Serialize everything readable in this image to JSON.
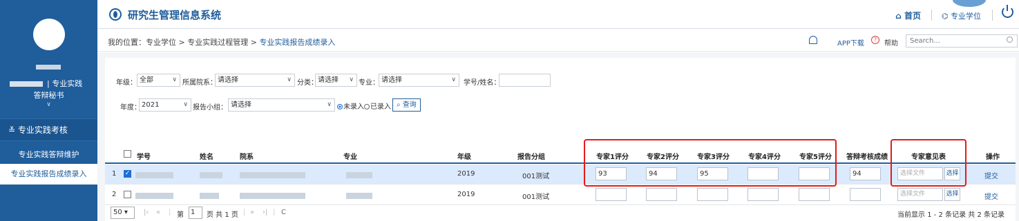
{
  "header": {
    "app_title": "研究生管理信息系统",
    "home": "首页",
    "degree": "专业学位"
  },
  "sidebar": {
    "role_suffix": "| 专业实践",
    "role_sub": "答辩秘书",
    "section": "专业实践考核",
    "items": [
      {
        "label": "专业实践答辩维护"
      },
      {
        "label": "专业实践报告成绩录入"
      }
    ]
  },
  "breadcrumb": {
    "prefix": "我的位置：",
    "path": "专业学位 > 专业实践过程管理 > ",
    "current": "专业实践报告成绩录入"
  },
  "toolbar": {
    "app_download": "APP下载",
    "help": "帮助",
    "search_placeholder": "Search..."
  },
  "filters": {
    "grade_label": "年级：",
    "grade_value": "全部",
    "college_label": "所属院系：",
    "college_value": "请选择",
    "category_label": "分类：",
    "category_value": "请选择",
    "major_label": "专业：",
    "major_value": "请选择",
    "student_label": "学号/姓名：",
    "year_label": "年度：",
    "year_value": "2021",
    "group_label": "报告小组：",
    "group_value": "请选择",
    "radio_unentered": "未录入",
    "radio_entered": "已录入",
    "query_button": "查询"
  },
  "table": {
    "columns": {
      "id": "学号",
      "name": "姓名",
      "college": "院系",
      "major": "专业",
      "grade": "年级",
      "group": "报告分组",
      "s1": "专家1评分",
      "s2": "专家2评分",
      "s3": "专家3评分",
      "s4": "专家4评分",
      "s5": "专家5评分",
      "final": "答辩考核成绩",
      "opinion": "专家意见表",
      "action": "操作"
    },
    "rows": [
      {
        "index": "1",
        "grade": "2019",
        "group": "001测试",
        "s1": "93",
        "s2": "94",
        "s3": "95",
        "s4": "",
        "s5": "",
        "final": "94",
        "file_placeholder": "选择文件",
        "pick": "选择",
        "action": "提交"
      },
      {
        "index": "2",
        "grade": "2019",
        "group": "001测试",
        "s1": "",
        "s2": "",
        "s3": "",
        "s4": "",
        "s5": "",
        "final": "",
        "file_placeholder": "选择文件",
        "pick": "选择",
        "action": "提交"
      }
    ]
  },
  "pager": {
    "page_size": "50",
    "page_prefix": "第",
    "page_value": "1",
    "page_suffix": "页 共 1 页",
    "info": "当前显示 1 - 2 条记录 共 2 条记录"
  },
  "colors": {
    "primary": "#1f5d9b",
    "highlight": "#e41a1a",
    "row_selected": "#dceafd"
  }
}
